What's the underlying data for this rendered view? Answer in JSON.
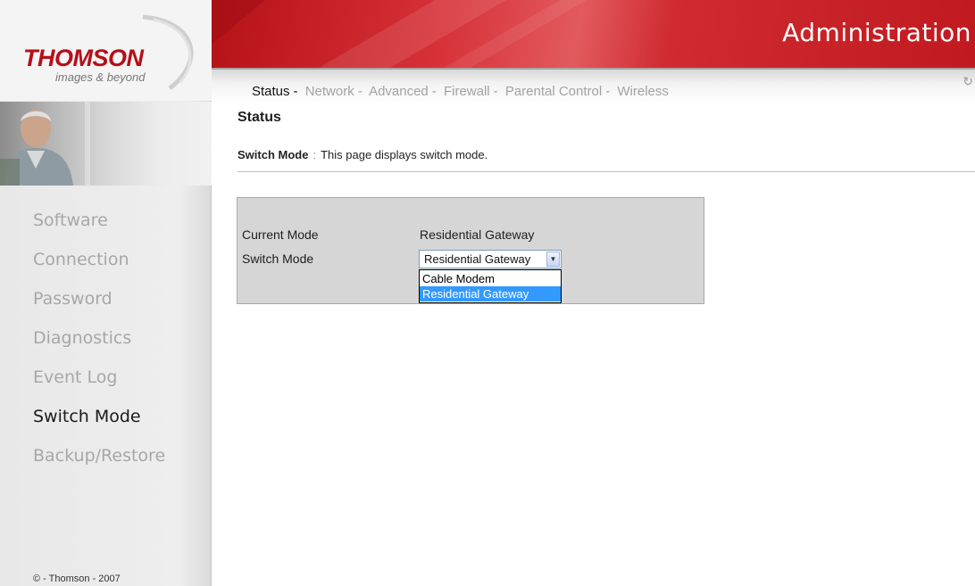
{
  "brand": {
    "name": "THOMSON",
    "tagline": "images & beyond"
  },
  "banner": {
    "title": "Administration"
  },
  "tabs": [
    {
      "label": "Status",
      "active": true
    },
    {
      "label": "Network",
      "active": false
    },
    {
      "label": "Advanced",
      "active": false
    },
    {
      "label": "Firewall",
      "active": false
    },
    {
      "label": "Parental Control",
      "active": false
    },
    {
      "label": "Wireless",
      "active": false
    }
  ],
  "tab_separator": "-",
  "sidebar": {
    "items": [
      {
        "label": "Software",
        "active": false
      },
      {
        "label": "Connection",
        "active": false
      },
      {
        "label": "Password",
        "active": false
      },
      {
        "label": "Diagnostics",
        "active": false
      },
      {
        "label": "Event Log",
        "active": false
      },
      {
        "label": "Switch Mode",
        "active": true
      },
      {
        "label": "Backup/Restore",
        "active": false
      }
    ],
    "copyright": "© - Thomson - 2007"
  },
  "main": {
    "page_title": "Status",
    "description_label": "Switch Mode",
    "description_separator": ":",
    "description_text": "This page displays switch mode.",
    "current_mode_label": "Current Mode",
    "current_mode_value": "Residential Gateway",
    "switch_mode_label": "Switch Mode",
    "switch_mode_selected": "Residential Gateway",
    "switch_mode_options": [
      "Cable Modem",
      "Residential Gateway"
    ],
    "highlighted_option_index": 1
  },
  "colors": {
    "brand_red": "#b50f19",
    "banner_red": "#c01a20",
    "selection_blue": "#3399ff",
    "panel_gray": "#d6d6d6"
  },
  "icons": {
    "refresh": "refresh-icon",
    "dropdown_arrow": "chevron-down-icon"
  }
}
